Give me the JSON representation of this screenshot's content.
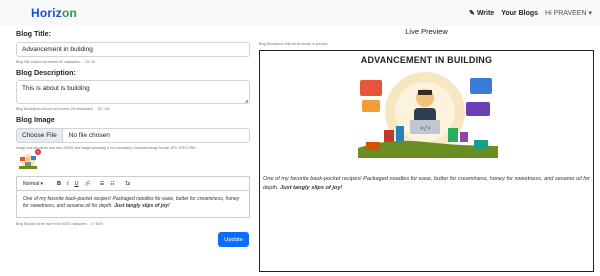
{
  "nav": {
    "brand_first": "Horiz",
    "brand_second": "on",
    "write_label": "Write",
    "blogs_label": "Your Blogs",
    "user_label": "Hi PRAVEEN",
    "colors": {
      "brand_blue": "#1a4fd0",
      "brand_green": "#24a148"
    }
  },
  "form": {
    "title_label": "Blog Title:",
    "title_value": "Advancement in building",
    "title_hint": "Blog Title should not exceed 50 characters.",
    "title_count": "23 / 50",
    "desc_label": "Blog Description:",
    "desc_value": "This is about is building",
    "desc_hint": "Blog Description should not exceed 100 characters.",
    "desc_count": "25 / 100",
    "image_label": "Blog Image",
    "file_button": "Choose File",
    "file_name": "No file chosen",
    "image_hint": "Image size should be less than 200KB and image uploading is not mandatory. Accepted image format: JPG, JPEG,PNG",
    "remove_icon": "×",
    "toolbar": {
      "format": "Normal",
      "bold": "B",
      "italic": "I",
      "underline": "U",
      "link": "🔗",
      "ol": "☰",
      "ul": "☷",
      "clear": "T̶x"
    },
    "content_text": "One of my favorite back-pocket recipes! Packaged noodles for ease, butter for creaminess, honey for sweetness, and sesame oil for depth.",
    "content_bold": "Just tangly slips of joy!",
    "content_hint": "Blog Should not be more than 5000 Characters",
    "content_count": "0 / 5000",
    "submit_label": "Update",
    "submit_color": "#0d6efd"
  },
  "preview": {
    "header": "Live Preview",
    "note": "Blog Description Will not be shown in preview",
    "title": "ADVANCEMENT IN BUILDING",
    "text": "One of my favorite back-pocket recipes! Packaged noodles for ease, butter for creaminess, honey for sweetness, and sesame oil for depth.",
    "bold": "Just tangly slips of joy!"
  }
}
